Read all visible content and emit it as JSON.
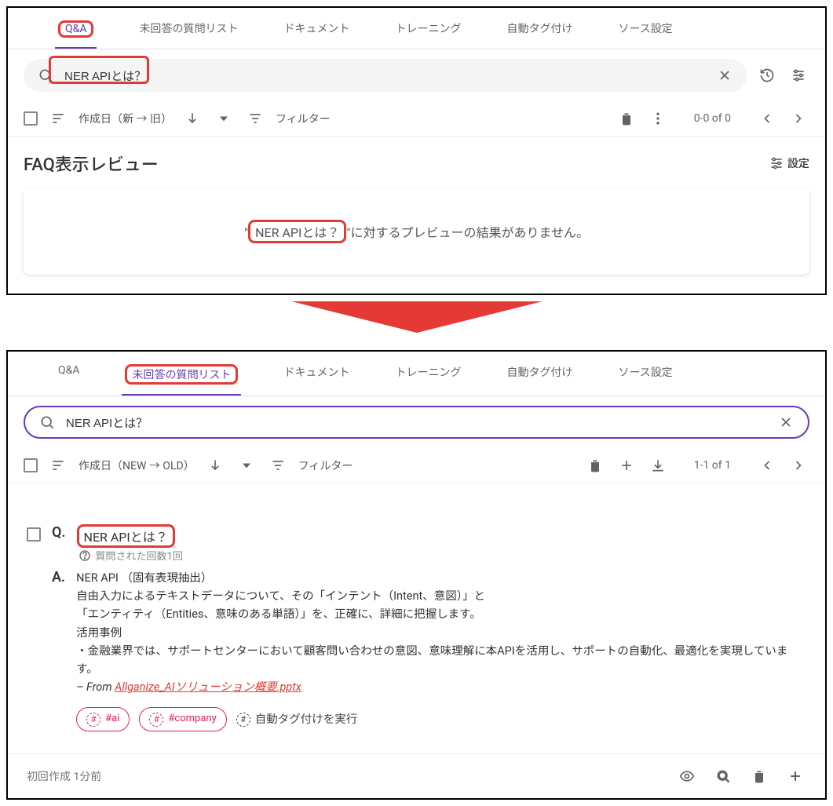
{
  "top": {
    "tabs": [
      "Q&A",
      "未回答の質問リスト",
      "ドキュメント",
      "トレーニング",
      "自動タグ付け",
      "ソース設定"
    ],
    "activeTab": 0,
    "search": {
      "value": "NER APIとは？"
    },
    "sort_label": "作成日（新 → 旧）",
    "filter_label": "フィルター",
    "pager": "0-0 of 0",
    "review_title": "FAQ表示レビュー",
    "settings_label": "設定",
    "preview_prefix": "\"",
    "preview_query": "NER APIとは？",
    "preview_suffix": "\"に対するプレビューの結果がありません。"
  },
  "bottom": {
    "tabs": [
      "Q&A",
      "未回答の質問リスト",
      "ドキュメント",
      "トレーニング",
      "自動タグ付け",
      "ソース設定"
    ],
    "activeTab": 1,
    "search": {
      "value": "NER APIとは？"
    },
    "sort_label": "作成日（NEW → OLD）",
    "filter_label": "フィルター",
    "pager": "1-1 of 1",
    "q_label": "Q.",
    "a_label": "A.",
    "question": "NER APIとは？",
    "asked_count": "質問された回数1回",
    "answer_lines": [
      "NER API （固有表現抽出）",
      "自由入力によるテキストデータについて、その「インテント（Intent、意図）」と",
      "「エンティティ（Entities、意味のある単語）」を、正確に、詳細に把握します。",
      "活用事例",
      "・金融業界では、サポートセンターにおいて顧客問い合わせの意図、意味理解に本APIを活用し、サポートの自動化、最適化を実現しています。"
    ],
    "from_prefix": "– From ",
    "from_link": "Allganize_AIソリューション概要.pptx",
    "tags": [
      "#ai",
      "#company"
    ],
    "autotag_label": "自動タグ付けを実行",
    "created_label": "初回作成 1分前"
  }
}
